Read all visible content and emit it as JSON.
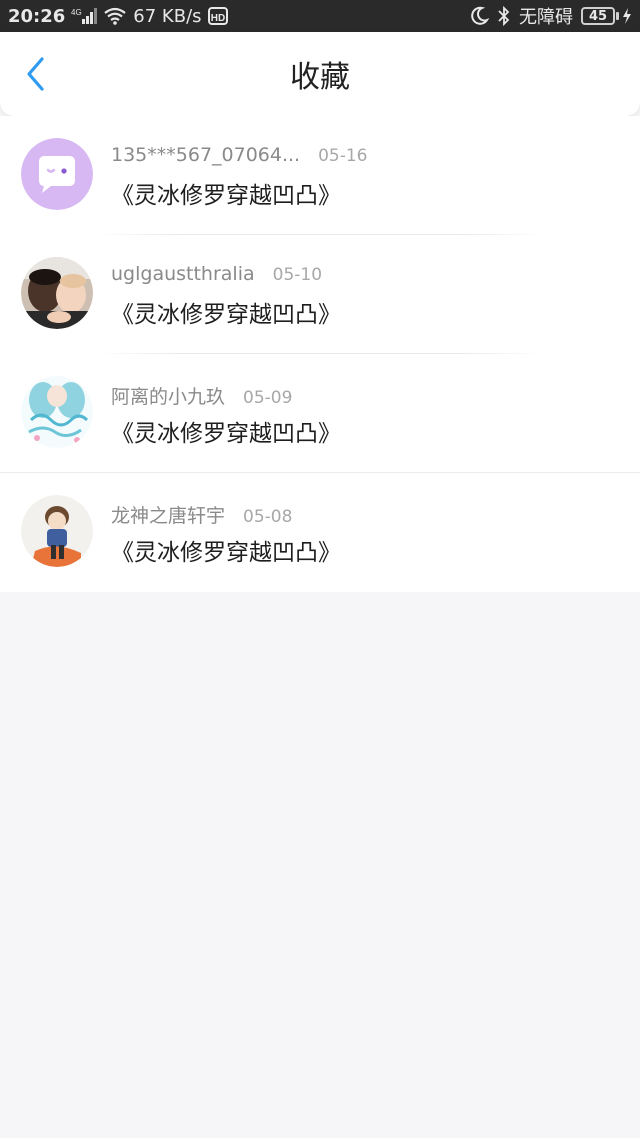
{
  "status_bar": {
    "time": "20:26",
    "network": "4G",
    "speed": "67 KB/s",
    "hd": "HD",
    "accessibility": "无障碍",
    "battery": "45"
  },
  "nav": {
    "title": "收藏"
  },
  "favorites": [
    {
      "name": "135***567_07064...",
      "date": "05-16",
      "book": "《灵冰修罗穿越凹凸》",
      "avatar": "chat-bubble-avatar"
    },
    {
      "name": "uglgaustthralia",
      "date": "05-10",
      "book": "《灵冰修罗穿越凹凸》",
      "avatar": "photo-avatar"
    },
    {
      "name": "阿离的小九玖",
      "date": "05-09",
      "book": "《灵冰修罗穿越凹凸》",
      "avatar": "anime-girl-avatar"
    },
    {
      "name": "龙神之唐轩宇",
      "date": "05-08",
      "book": "《灵冰修罗穿越凹凸》",
      "avatar": "anime-boy-avatar"
    }
  ],
  "colors": {
    "accent": "#2f9bf0",
    "background": "#f6f5f7",
    "avatar_purple": "#d7b8f3"
  }
}
